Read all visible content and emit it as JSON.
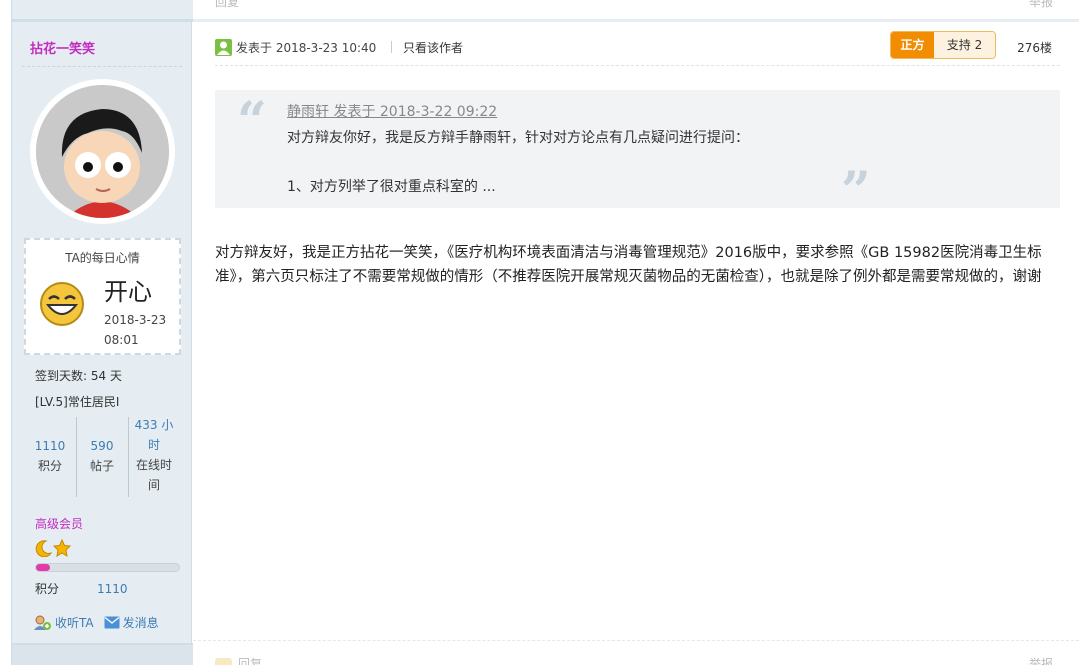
{
  "top_actions": {
    "reply": "回复",
    "report": "举报"
  },
  "author": {
    "name": "拈花一笑笑",
    "mood_title": "TA的每日心情",
    "mood": "开心",
    "mood_time": "2018-3-23 08:01",
    "checkin": "签到天数: 54 天",
    "level": "[LV.5]常住居民I",
    "stats": [
      {
        "value": "1110",
        "label": "积分"
      },
      {
        "value": "590",
        "label": "帖子"
      },
      {
        "value": "433 小时",
        "label": "在线时间"
      }
    ],
    "group": "高级会员",
    "progress": 0.1,
    "points_label": "积分",
    "points_value": "1110",
    "follow": "收听TA",
    "message": "发消息"
  },
  "post": {
    "time": "发表于 2018-3-23 10:40",
    "only_author": "只看该作者",
    "side": "正方",
    "support": "支持 2",
    "floor": "276楼",
    "quote_meta": "静雨轩 发表于 2018-3-22 09:22",
    "quote_line1": "对方辩友你好，我是反方辩手静雨轩，针对对方论点有几点疑问进行提问：",
    "quote_line2": "1、对方列举了很对重点科室的 ...",
    "body": "对方辩友好，我是正方拈花一笑笑，《医疗机构环境表面清洁与消毒管理规范》2016版中，要求参照《GB 15982医院消毒卫生标准》，第六页只标注了不需要常规做的情形（不推荐医院开展常规灭菌物品的无菌检查），也就是除了例外都是需要常规做的，谢谢"
  },
  "colors": {
    "accent": "#c42bbf",
    "link": "#3c7cb5",
    "side_badge": "#f28c00"
  }
}
